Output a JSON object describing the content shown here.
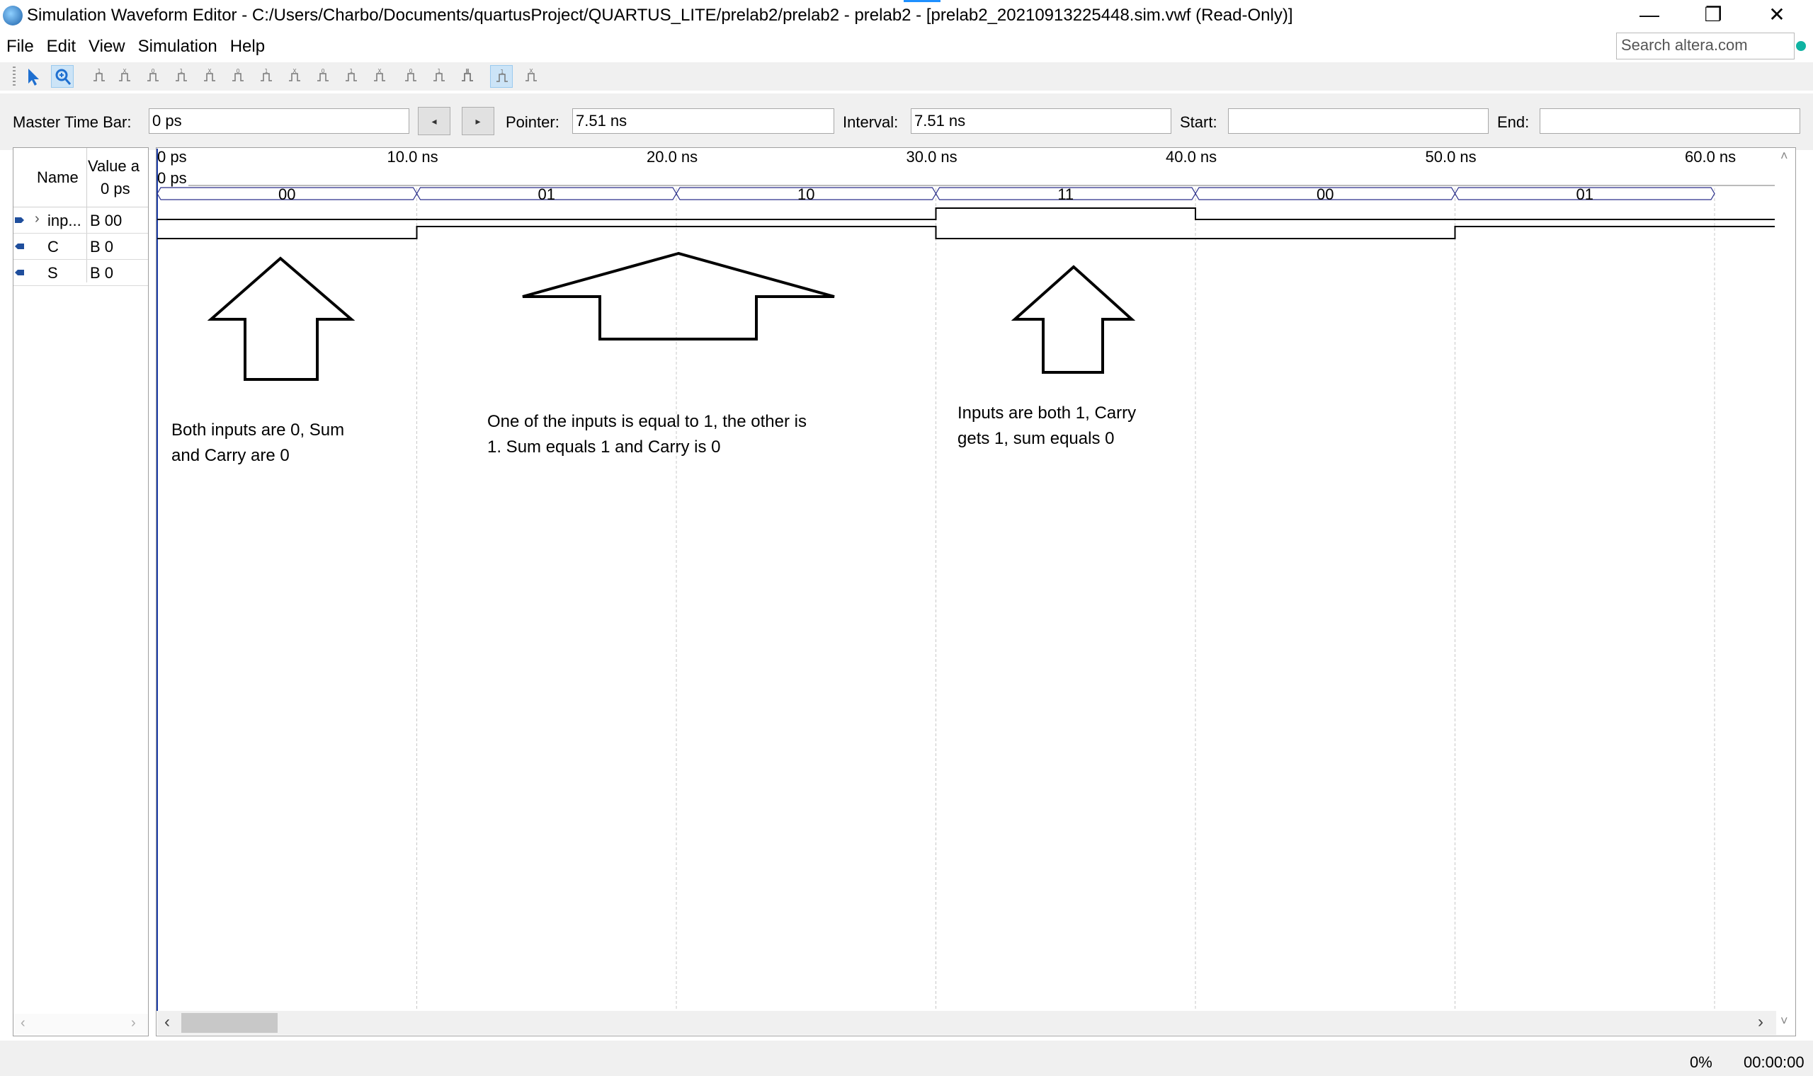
{
  "window": {
    "title": "Simulation Waveform Editor - C:/Users/Charbo/Documents/quartusProject/QUARTUS_LITE/prelab2/prelab2 - prelab2 - [prelab2_20210913225448.sim.vwf (Read-Only)]",
    "minimize": "—",
    "restore": "❐",
    "close": "✕"
  },
  "menu": {
    "items": [
      "File",
      "Edit",
      "View",
      "Simulation",
      "Help"
    ],
    "search_placeholder": "Search altera.com"
  },
  "toolbar": {
    "tools": [
      "selection-tool-icon",
      "zoom-tool-icon",
      "force-unknown-icon",
      "force-low-icon",
      "force-high-icon",
      "force-hi-z-icon",
      "force-weak-low-icon",
      "force-weak-high-icon",
      "force-dont-care-icon",
      "invert-icon",
      "count-value-icon",
      "clock-icon",
      "arbitrary-value-icon",
      "random-values-icon",
      "run-functional-simulation-icon",
      "run-timing-simulation-icon",
      "generate-netlist-icon",
      "snap-to-grid-icon",
      "grid-settings-icon"
    ],
    "active_tools": [
      "zoom-tool-icon",
      "snap-to-grid-icon"
    ]
  },
  "timebar": {
    "master_label": "Master Time Bar:",
    "master_value": "0 ps",
    "prev_label": "◂",
    "next_label": "▸",
    "pointer_label": "Pointer:",
    "pointer_value": "7.51 ns",
    "interval_label": "Interval:",
    "interval_value": "7.51 ns",
    "start_label": "Start:",
    "start_value": "",
    "end_label": "End:",
    "end_value": ""
  },
  "signal_table": {
    "col_name": "Name",
    "col_value": "Value a",
    "col_value_time": "0 ps",
    "signals": [
      {
        "name": "inp...",
        "value": "B 00",
        "type": "input",
        "expandable": true
      },
      {
        "name": "C",
        "value": "B 0",
        "type": "output",
        "expandable": false
      },
      {
        "name": "S",
        "value": "B 0",
        "type": "output",
        "expandable": false
      }
    ]
  },
  "waveform": {
    "time_unit": "ns",
    "ruler_labels": [
      "0 ps",
      "10.0 ns",
      "20.0 ns",
      "30.0 ns",
      "40.0 ns",
      "50.0 ns",
      "60.0 ns"
    ],
    "cursor_label": "0 ps",
    "bus_segments": [
      {
        "start": 0,
        "end": 10,
        "value": "00"
      },
      {
        "start": 10,
        "end": 20,
        "value": "01"
      },
      {
        "start": 20,
        "end": 30,
        "value": "10"
      },
      {
        "start": 30,
        "end": 40,
        "value": "11"
      },
      {
        "start": 40,
        "end": 50,
        "value": "00"
      },
      {
        "start": 50,
        "end": 60,
        "value": "01"
      }
    ],
    "C_transitions": [
      [
        0,
        0
      ],
      [
        30,
        1
      ],
      [
        40,
        0
      ]
    ],
    "S_transitions": [
      [
        0,
        0
      ],
      [
        10,
        1
      ],
      [
        30,
        0
      ],
      [
        50,
        1
      ]
    ],
    "annotations": [
      {
        "line1": "Both inputs are 0, Sum",
        "line2": "and Carry are 0"
      },
      {
        "line1": "One of the inputs is equal to 1, the other is",
        "line2": "1. Sum equals 1 and Carry is 0"
      },
      {
        "line1": "Inputs are both 1, Carry",
        "line2": "gets 1, sum equals 0"
      }
    ]
  },
  "status": {
    "progress": "0%",
    "elapsed": "00:00:00"
  }
}
